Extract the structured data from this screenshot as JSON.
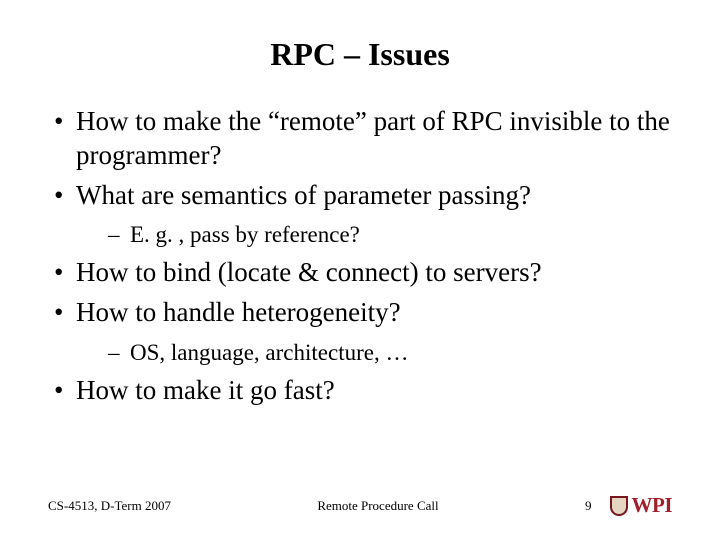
{
  "title": "RPC – Issues",
  "bullets": {
    "b0": "How to make the “remote” part of RPC invisible to the programmer?",
    "b1": "What are semantics of parameter passing?",
    "b1s0": "E. g. , pass by reference?",
    "b2": "How to bind (locate & connect) to servers?",
    "b3": "How to handle heterogeneity?",
    "b3s0": "OS, language, architecture, …",
    "b4": "How to make it go fast?"
  },
  "footer": {
    "left": "CS-4513, D-Term 2007",
    "center": "Remote Procedure Call",
    "page": "9"
  },
  "logo": {
    "text": "WPI"
  }
}
